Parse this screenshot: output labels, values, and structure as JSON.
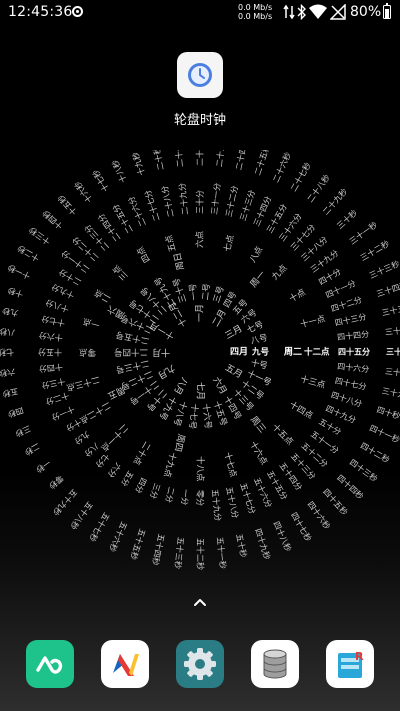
{
  "status_bar": {
    "time": "12:45:36",
    "net_up": "0.0 Mb/s",
    "net_down": "0.0 Mb/s",
    "battery": "80%"
  },
  "shortcut": {
    "label": "轮盘时钟",
    "icon": "clock-icon"
  },
  "clock": {
    "month": "四月",
    "day": "九号",
    "weekday": "周二",
    "hour": "十二点",
    "minute": "四十五分",
    "second": "三十七秒"
  },
  "dock": [
    {
      "name": "infinity-app",
      "icon": "infinity-icon",
      "color": "#1ec28b"
    },
    {
      "name": "v-logo-app",
      "icon": "v-logo-icon",
      "color": "#ffffff"
    },
    {
      "name": "settings-app",
      "icon": "gear-icon",
      "color": "#2a7d85"
    },
    {
      "name": "database-app",
      "icon": "database-icon",
      "color": "#ffffff"
    },
    {
      "name": "file-manager-app",
      "icon": "folder-r-icon",
      "color": "#ffffff"
    }
  ]
}
